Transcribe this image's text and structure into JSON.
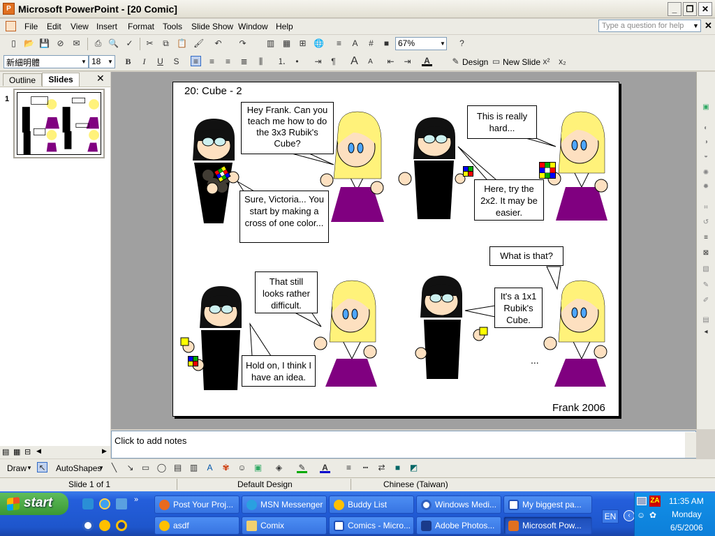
{
  "window": {
    "title": "Microsoft PowerPoint - [20 Comic]",
    "app_icon": "P"
  },
  "menu": [
    "File",
    "Edit",
    "View",
    "Insert",
    "Format",
    "Tools",
    "Slide Show",
    "Window",
    "Help"
  ],
  "help_box": {
    "placeholder": "Type a question for help"
  },
  "toolbar": {
    "zoom": "67%"
  },
  "formatting": {
    "font": "新細明體",
    "size": "18",
    "design_label": "Design",
    "new_slide_label": "New Slide"
  },
  "left_pane": {
    "tab_outline": "Outline",
    "tab_slides": "Slides",
    "slide_number": "1"
  },
  "slide": {
    "title": "20: Cube - 2",
    "footer": "Frank 2006",
    "bubble1": "Hey Frank.  Can you teach me how to do the 3x3 Rubik's Cube?",
    "bubble2": "Sure, Victoria... You start by making a cross of one color...",
    "bubble3": "This is really hard...",
    "bubble4": "Here, try the 2x2.  It may be easier.",
    "bubble5": "That still looks rather difficult.",
    "bubble6": "Hold on, I think I have an idea.",
    "bubble7": "What is that?",
    "bubble8": "It's a 1x1 Rubik's Cube.",
    "ellipsis": "..."
  },
  "notes": {
    "placeholder": "Click to add notes"
  },
  "drawing": {
    "draw_label": "Draw",
    "autoshapes_label": "AutoShapes"
  },
  "status": {
    "slide": "Slide 1 of 1",
    "design": "Default Design",
    "language": "Chinese (Taiwan)"
  },
  "taskbar": {
    "start_label": "start",
    "row1": [
      "Post Your Proj...",
      "MSN Messenger",
      "Buddy List",
      "Windows Medi...",
      "My biggest pa..."
    ],
    "row2": [
      "asdf",
      "Comix",
      "Comics - Micro...",
      "Adobe Photos...",
      "Microsoft Pow..."
    ],
    "lang": "EN",
    "clock": {
      "time": "11:35 AM",
      "day": "Monday",
      "date": "6/5/2006"
    }
  },
  "colors": {
    "taskbar": "#245edb",
    "start": "#3a9834",
    "skirt": "#800080",
    "hair": "#fff27a"
  }
}
